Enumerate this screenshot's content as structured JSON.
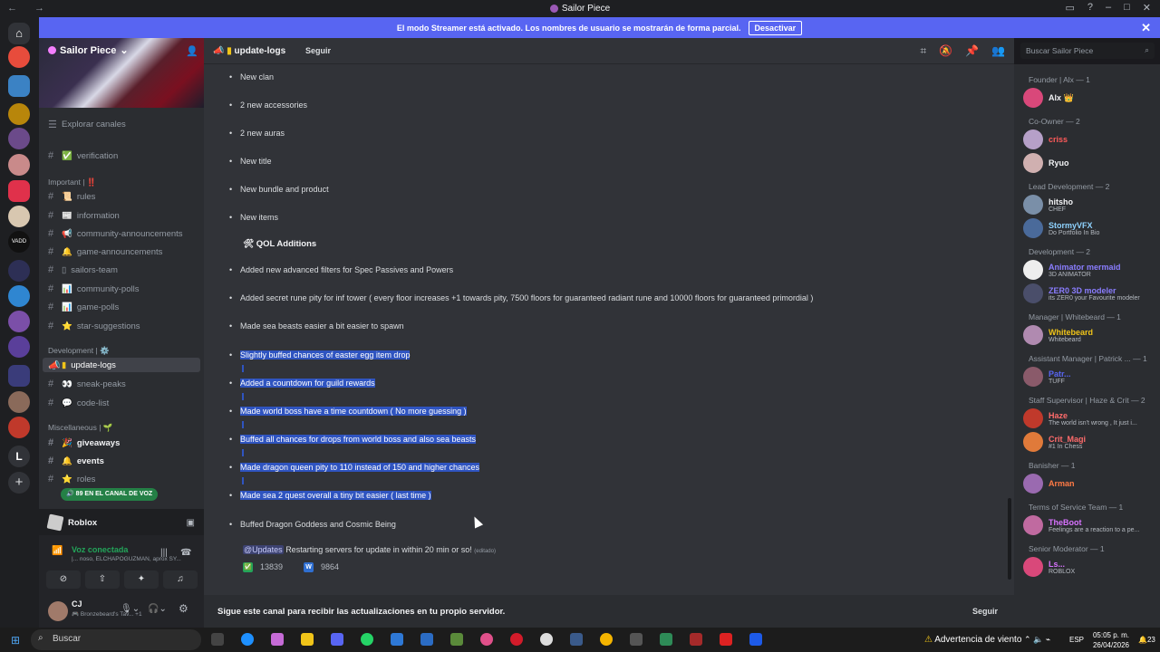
{
  "window": {
    "title": "Sailor Piece"
  },
  "banner": {
    "text": "El modo Streamer está activado. Los nombres de usuario se mostrarán de forma parcial.",
    "button": "Desactivar"
  },
  "server": {
    "name": "Sailor Piece",
    "explore": "Explorar canales"
  },
  "channels": [
    {
      "label": "verification",
      "icon": "✅"
    },
    {
      "label": "rules",
      "icon": "📜"
    },
    {
      "label": "information",
      "icon": "📰"
    },
    {
      "label": "community-announcements",
      "icon": "📢"
    },
    {
      "label": "game-announcements",
      "icon": "🔔"
    },
    {
      "label": "sailors-team",
      "icon": "▯"
    },
    {
      "label": "community-polls",
      "icon": "📊"
    },
    {
      "label": "game-polls",
      "icon": "📊"
    },
    {
      "label": "star-suggestions",
      "icon": "⭐"
    },
    {
      "label": "update-logs",
      "icon": "▮"
    },
    {
      "label": "sneak-peaks",
      "icon": "👀"
    },
    {
      "label": "code-list",
      "icon": "💬"
    },
    {
      "label": "giveaways",
      "icon": "🎉"
    },
    {
      "label": "events",
      "icon": "🔔"
    },
    {
      "label": "roles",
      "icon": "⭐"
    }
  ],
  "categories": {
    "important": "Important | ‼️",
    "development": "Development | ⚙️",
    "misc": "Miscellaneous | 🌱"
  },
  "voice_pill": "89 EN EL CANAL DE VOZ",
  "voice": {
    "app": "Roblox",
    "status": "Voz conectada",
    "detail": "|... noso, ELCHAPOGUZMAN, aprox SY..."
  },
  "user": {
    "name": "CJ",
    "status": "Bronzebeard's Tav...",
    "extra": "+1"
  },
  "header": {
    "channel": "update-logs",
    "follow": "Seguir"
  },
  "search": {
    "placeholder": "Buscar Sailor Piece"
  },
  "messages": {
    "items": [
      "New clan",
      "2 new accessories",
      "2 new auras",
      "New title",
      "New bundle and product",
      "New items"
    ],
    "qol_title": "QOL Additions",
    "qol": [
      "Added new advanced filters for Spec Passives and Powers",
      "Added secret rune pity for inf tower ( every floor increases +1 towards pity, 7500 floors for guaranteed radiant rune and 10000 floors for guaranteed primordial )",
      "Made sea beasts easier a bit easier to spawn",
      "Slightly buffed chances of easter egg item drop",
      "Added a countdown for guild rewards",
      "Made world boss have a time countdown ( No more guessing )",
      "Buffed all chances for drops from world boss and also sea beasts",
      "Made dragon queen pity to 110 instead of 150 and higher chances",
      "Made sea 2 quest overall a tiny bit easier ( last time )",
      "Buffed Dragon Goddess and Cosmic Being"
    ],
    "mention": "@Updates",
    "final": "Restarting servers for update in within 20 min or so!",
    "edited": "(editado)",
    "reactions": [
      {
        "emoji": "✅",
        "count": "13839"
      },
      {
        "emoji": "W",
        "count": "9864"
      }
    ]
  },
  "footer": {
    "text": "Sigue este canal para recibir las actualizaciones en tu propio servidor.",
    "button": "Seguir"
  },
  "members": [
    {
      "role": "Founder | Alx — 1",
      "people": [
        {
          "name": "Alx 👑",
          "color": "#f2f3f5",
          "sub": ""
        }
      ]
    },
    {
      "role": "Co-Owner — 2",
      "people": [
        {
          "name": "criss",
          "color": "#ff5a5a",
          "sub": ""
        },
        {
          "name": "Ryuo",
          "color": "#f2f3f5",
          "sub": ""
        }
      ]
    },
    {
      "role": "Lead Development — 2",
      "people": [
        {
          "name": "hitsho",
          "color": "#f2f3f5",
          "sub": "CHEF"
        },
        {
          "name": "StormyVFX",
          "color": "#8fd3ff",
          "sub": "Do Portfolio In Bio"
        }
      ]
    },
    {
      "role": "Development — 2",
      "people": [
        {
          "name": "Animator mermaid",
          "color": "#8a7dff",
          "sub": "3D ANIMATOR"
        },
        {
          "name": "ZER0 3D modeler",
          "color": "#8a7dff",
          "sub": "its ZER0 your Favourite modeler"
        }
      ]
    },
    {
      "role": "Manager | Whitebeard — 1",
      "people": [
        {
          "name": "Whitebeard",
          "color": "#f0c419",
          "sub": "Whitebeard"
        }
      ]
    },
    {
      "role": "Assistant Manager | Patrick ... — 1",
      "people": [
        {
          "name": "Patr...",
          "color": "#5865f2",
          "sub": "TUFF"
        }
      ]
    },
    {
      "role": "Staff Supervisor | Haze & Crit — 2",
      "people": [
        {
          "name": "Haze",
          "color": "#ff6b6b",
          "sub": "The world isn't wrong , It just i..."
        },
        {
          "name": "Crit_Magi",
          "color": "#ff6b6b",
          "sub": "#1 In Chess"
        }
      ]
    },
    {
      "role": "Banisher — 1",
      "people": [
        {
          "name": "Arman",
          "color": "#ff7a45",
          "sub": ""
        }
      ]
    },
    {
      "role": "Terms of Service Team — 1",
      "people": [
        {
          "name": "TheBoot",
          "color": "#d873ff",
          "sub": "Feelings are a reaction to a pe..."
        }
      ]
    },
    {
      "role": "Senior Moderator — 1",
      "people": [
        {
          "name": "Ls...",
          "color": "#d873ff",
          "sub": "ROBLOX"
        }
      ]
    }
  ],
  "taskbar": {
    "search": "Buscar",
    "weather": "Advertencia de viento",
    "lang": "ESP",
    "time": "05:05 p. m.",
    "date": "26/04/2026",
    "notif": "23"
  }
}
